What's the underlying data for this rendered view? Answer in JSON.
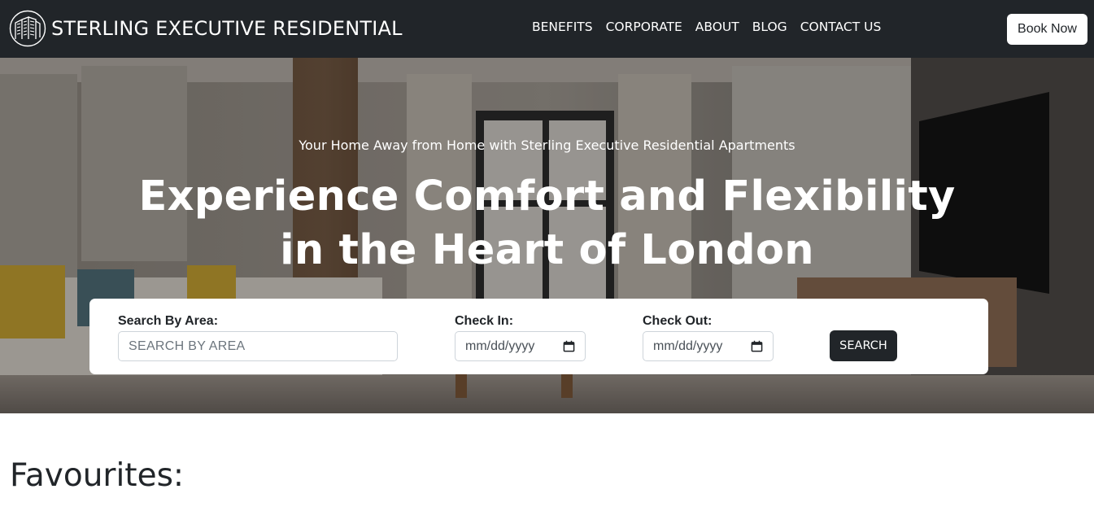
{
  "navbar": {
    "brand_name": "STERLING EXECUTIVE RESIDENTIAL",
    "logo_icon": "building-logo-icon",
    "links": [
      "BENEFITS",
      "CORPORATE",
      "ABOUT",
      "BLOG",
      "CONTACT US"
    ],
    "book_button": "Book Now"
  },
  "hero": {
    "subtitle": "Your Home Away from Home with Sterling Executive Residential Apartments",
    "title_line1": "Experience Comfort and Flexibility",
    "title_line2": "in the Heart of London"
  },
  "search": {
    "area_label": "Search By Area:",
    "area_placeholder": "SEARCH BY AREA",
    "checkin_label": "Check In:",
    "checkin_value": "mm/dd/yyyy",
    "checkout_label": "Check Out:",
    "checkout_value": "mm/dd/yyyy",
    "button": "SEARCH"
  },
  "favourites": {
    "title": "Favourites:"
  },
  "colors": {
    "navbar_bg": "#212529",
    "primary_dark": "#212529",
    "white": "#ffffff"
  }
}
